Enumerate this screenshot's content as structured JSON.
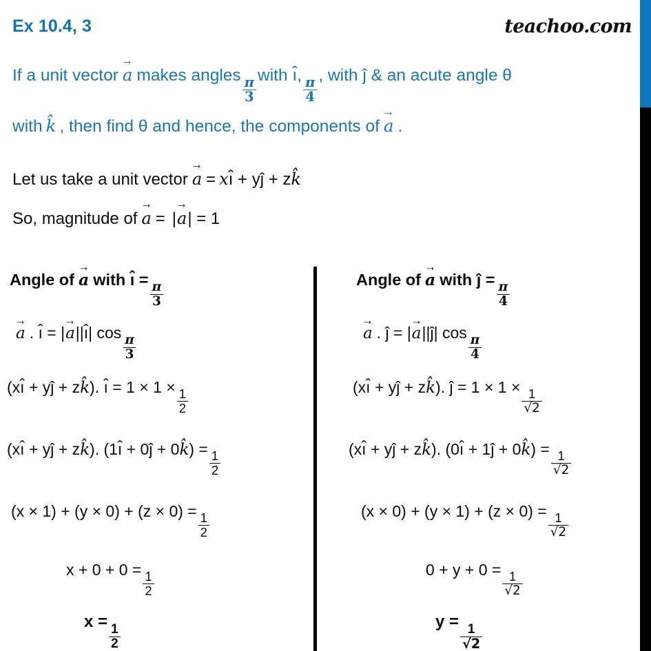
{
  "header": {
    "exercise_label": "Ex 10.4, 3",
    "brand": "teachoo.com",
    "accent_color": "#0F72B5",
    "edge_blue": "#0F75BC",
    "edge_black": "#000000"
  },
  "question": {
    "color": "#1B75BB",
    "line1_a": "If a unit vector",
    "line1_b": "a",
    "line1_c": "makes angles",
    "line1_frac1_num": "π",
    "line1_frac1_den": "3",
    "line1_d": "with ı̂,",
    "line1_frac2_num": "π",
    "line1_frac2_den": "4",
    "line1_e": ", with ĵ & an acute angle θ",
    "line2_a": "with",
    "line2_b": "k̂",
    "line2_c": ", then find θ and hence, the components of",
    "line2_d": "a",
    "line2_e": "."
  },
  "statements": {
    "line1_a": "Let us take a unit vector",
    "line1_b": "a",
    "line1_c": "=",
    "line1_d": "x",
    "line1_e": "ı̂ + yĵ + z",
    "line1_f": "k̂",
    "line2_a": "So, magnitude of",
    "line2_b": "a",
    "line2_c": "=",
    "line2_d": "|",
    "line2_e": "a",
    "line2_f": "| = 1"
  },
  "columns": [
    {
      "id": "left",
      "axis": "i-hat",
      "heading": {
        "text_a": "Angle of",
        "vec": "a",
        "text_b": "with ı̂ =",
        "frac_num": "π",
        "frac_den": "3"
      },
      "rows": [
        {
          "name": "dot-product-definition",
          "lhs": "a",
          "text_a": ". ı̂ = |",
          "vec2": "a",
          "text_b": "||ı̂| cos",
          "frac_num": "π",
          "frac_den": "3"
        },
        {
          "name": "substitute-components",
          "text_a": "(xı̂ + yĵ + z",
          "khat": "k̂",
          "text_b": "). ı̂ = 1 × 1 ×",
          "frac_num": "1",
          "frac_den": "2"
        },
        {
          "name": "expand-unit-vector",
          "text_a": "(xı̂ + yĵ + z",
          "khat": "k̂",
          "text_b": "). (1ı̂ + 0ĵ + 0",
          "khat2": "k̂",
          "text_c": ") =",
          "frac_num": "1",
          "frac_den": "2"
        },
        {
          "name": "componentwise-product",
          "text_a": "(x × 1) + (y × 0) + (z × 0) =",
          "frac_num": "1",
          "frac_den": "2"
        },
        {
          "name": "simplified-sum",
          "text_a": "x + 0 + 0 =",
          "frac_num": "1",
          "frac_den": "2"
        },
        {
          "name": "result",
          "text_a": "x =",
          "frac_num": "1",
          "frac_den": "2"
        }
      ]
    },
    {
      "id": "right",
      "axis": "j-hat",
      "heading": {
        "text_a": "Angle of",
        "vec": "a",
        "text_b": "with ĵ =",
        "frac_num": "π",
        "frac_den": "4"
      },
      "rows": [
        {
          "name": "dot-product-definition",
          "lhs": "a",
          "text_a": ". ĵ = |",
          "vec2": "a",
          "text_b": "||ĵ| cos",
          "frac_num": "π",
          "frac_den": "4"
        },
        {
          "name": "substitute-components",
          "text_a": "(xı̂ + yĵ + z",
          "khat": "k̂",
          "text_b": "). ĵ = 1 × 1 ×",
          "frac_num": "1",
          "frac_den": "√2"
        },
        {
          "name": "expand-unit-vector",
          "text_a": "(xı̂ + yĵ + z",
          "khat": "k̂",
          "text_b": "). (0ı̂ + 1ĵ + 0",
          "khat2": "k̂",
          "text_c": ") =",
          "frac_num": "1",
          "frac_den": "√2"
        },
        {
          "name": "componentwise-product",
          "text_a": "(x  ×  0) + (y × 1) + (z × 0) =",
          "frac_num": "1",
          "frac_den": "√2"
        },
        {
          "name": "simplified-sum",
          "text_a": "0 + y + 0 =",
          "frac_num": "1",
          "frac_den": "√2"
        },
        {
          "name": "result",
          "text_a": "y =",
          "frac_num": "1",
          "frac_den": "√2"
        }
      ]
    }
  ]
}
